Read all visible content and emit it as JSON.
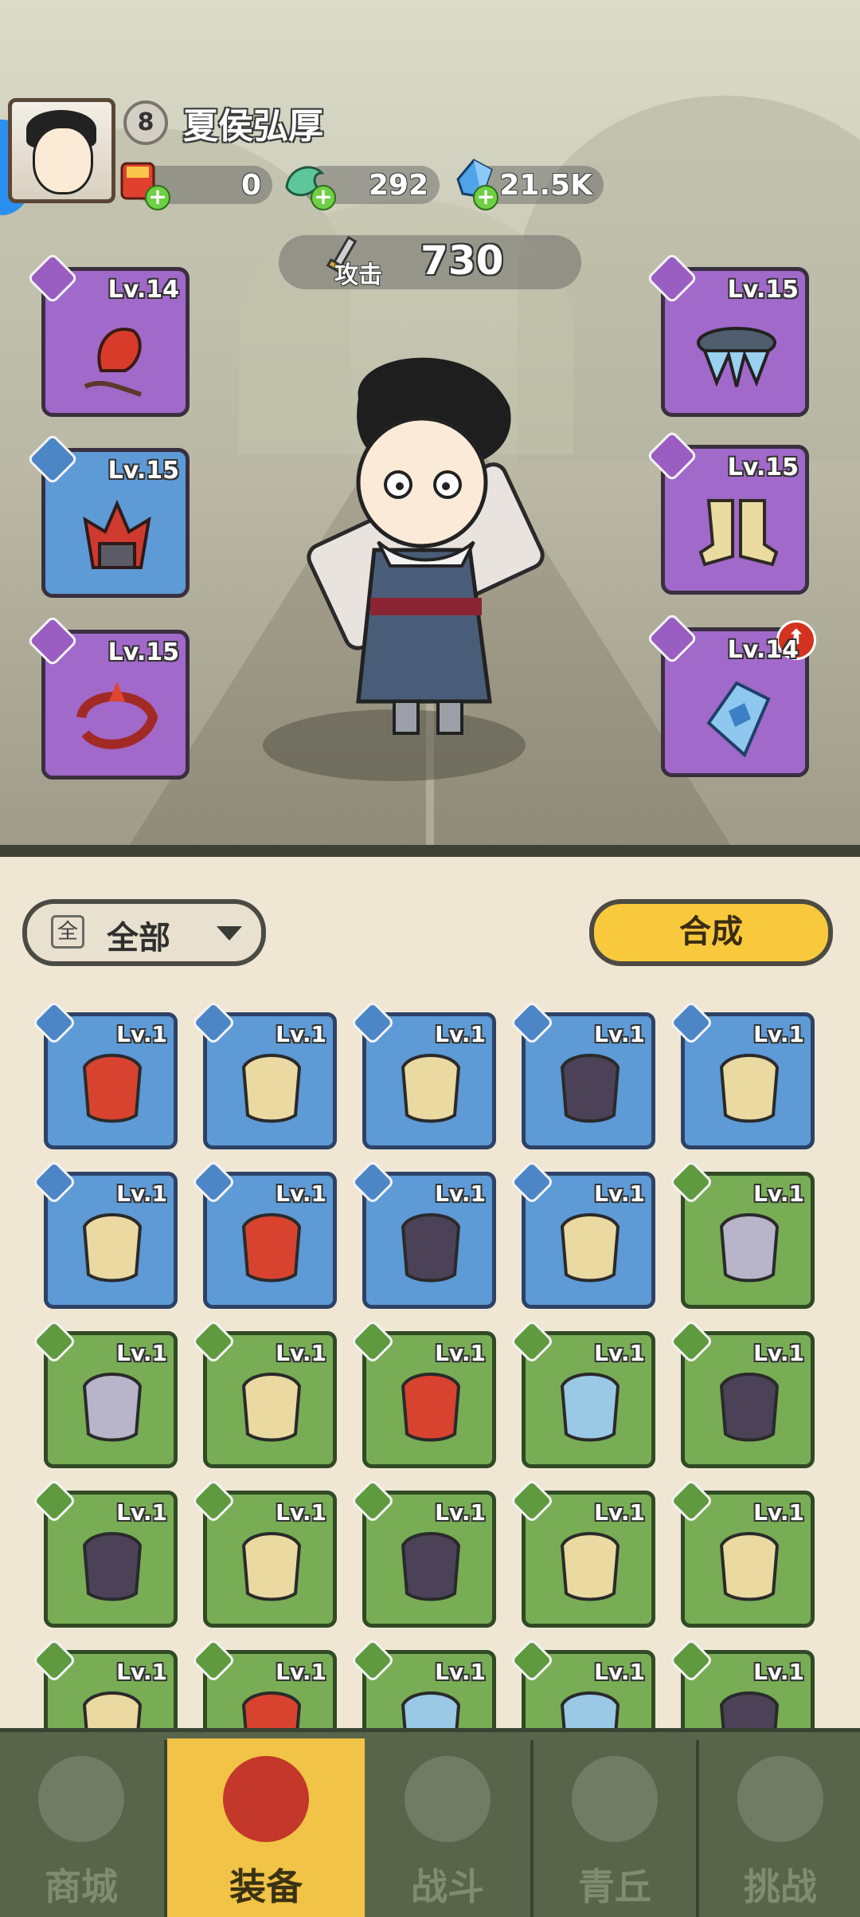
{
  "player": {
    "level": "8",
    "name": "夏侯弘厚"
  },
  "resources": [
    {
      "name": "red-envelope",
      "value": "0"
    },
    {
      "name": "jade-dragon",
      "value": "292"
    },
    {
      "name": "crystal",
      "value": "21.5K"
    }
  ],
  "attack": {
    "label": "攻击",
    "value": "730"
  },
  "equipped": [
    {
      "level": "Lv.14",
      "rarity": "purple",
      "icon": "flame-whip-icon"
    },
    {
      "level": "Lv.15",
      "rarity": "blue",
      "icon": "demon-helmet-icon"
    },
    {
      "level": "Lv.15",
      "rarity": "purple",
      "icon": "crimson-ring-icon"
    },
    {
      "level": "Lv.15",
      "rarity": "purple",
      "icon": "frost-belt-icon"
    },
    {
      "level": "Lv.15",
      "rarity": "purple",
      "icon": "golden-boots-icon"
    },
    {
      "level": "Lv.14",
      "rarity": "purple",
      "icon": "crystal-pendant-icon"
    }
  ],
  "filter": {
    "icon_text": "全",
    "label": "全部"
  },
  "merge_button": "合成",
  "inventory": [
    {
      "level": "Lv.1",
      "rarity": "blue",
      "icon": "flame-whip-icon"
    },
    {
      "level": "Lv.1",
      "rarity": "blue",
      "icon": "golden-armor-icon"
    },
    {
      "level": "Lv.1",
      "rarity": "blue",
      "icon": "golden-armor-icon"
    },
    {
      "level": "Lv.1",
      "rarity": "blue",
      "icon": "shadow-boots-icon"
    },
    {
      "level": "Lv.1",
      "rarity": "blue",
      "icon": "golden-boots-icon"
    },
    {
      "level": "Lv.1",
      "rarity": "blue",
      "icon": "golden-boots-icon"
    },
    {
      "level": "Lv.1",
      "rarity": "blue",
      "icon": "flame-orb-icon"
    },
    {
      "level": "Lv.1",
      "rarity": "blue",
      "icon": "void-amulet-icon"
    },
    {
      "level": "Lv.1",
      "rarity": "blue",
      "icon": "fang-necklace-icon"
    },
    {
      "level": "Lv.1",
      "rarity": "green",
      "icon": "stone-hammer-icon"
    },
    {
      "level": "Lv.1",
      "rarity": "green",
      "icon": "stone-hammer-icon"
    },
    {
      "level": "Lv.1",
      "rarity": "green",
      "icon": "golden-staff-icon"
    },
    {
      "level": "Lv.1",
      "rarity": "green",
      "icon": "demon-helmet-icon"
    },
    {
      "level": "Lv.1",
      "rarity": "green",
      "icon": "frost-armor-icon"
    },
    {
      "level": "Lv.1",
      "rarity": "green",
      "icon": "shadow-armor-icon"
    },
    {
      "level": "Lv.1",
      "rarity": "green",
      "icon": "shadow-armor-icon"
    },
    {
      "level": "Lv.1",
      "rarity": "green",
      "icon": "golden-armor-icon"
    },
    {
      "level": "Lv.1",
      "rarity": "green",
      "icon": "shadow-ring-icon"
    },
    {
      "level": "Lv.1",
      "rarity": "green",
      "icon": "ivory-ring-icon"
    },
    {
      "level": "Lv.1",
      "rarity": "green",
      "icon": "ivory-ring-icon"
    },
    {
      "level": "Lv.1",
      "rarity": "green",
      "icon": "ivory-ring-icon"
    },
    {
      "level": "Lv.1",
      "rarity": "green",
      "icon": "flame-belt-icon"
    },
    {
      "level": "Lv.1",
      "rarity": "green",
      "icon": "frost-belt-icon"
    },
    {
      "level": "Lv.1",
      "rarity": "green",
      "icon": "frost-belt-icon"
    },
    {
      "level": "Lv.1",
      "rarity": "green",
      "icon": "shadow-belt-icon"
    }
  ],
  "nav": [
    {
      "label": "商城",
      "icon": "shop-icon",
      "active": false
    },
    {
      "label": "装备",
      "icon": "equipment-icon",
      "active": true
    },
    {
      "label": "战斗",
      "icon": "crossed-swords-icon",
      "active": false
    },
    {
      "label": "青丘",
      "icon": "mountain-icon",
      "active": false
    },
    {
      "label": "挑战",
      "icon": "challenge-orb-icon",
      "active": false
    }
  ],
  "colors": {
    "purple": "#a169c9",
    "blue": "#5d9ad6",
    "green": "#78ad55",
    "accent": "#f8c93c"
  }
}
